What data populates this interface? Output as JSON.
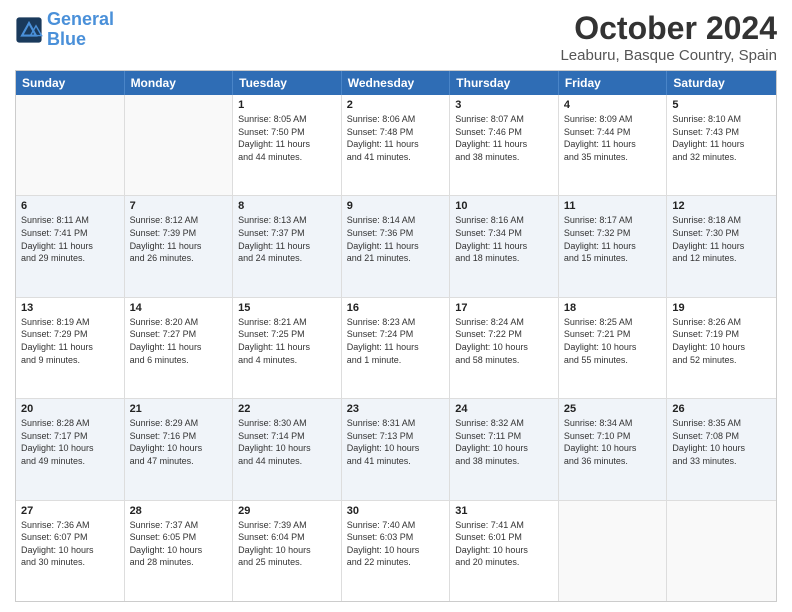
{
  "header": {
    "logo_general": "General",
    "logo_blue": "Blue",
    "month_title": "October 2024",
    "location": "Leaburu, Basque Country, Spain"
  },
  "days_of_week": [
    "Sunday",
    "Monday",
    "Tuesday",
    "Wednesday",
    "Thursday",
    "Friday",
    "Saturday"
  ],
  "weeks": [
    {
      "alt": false,
      "cells": [
        {
          "empty": true,
          "day": "",
          "lines": []
        },
        {
          "empty": true,
          "day": "",
          "lines": []
        },
        {
          "empty": false,
          "day": "1",
          "lines": [
            "Sunrise: 8:05 AM",
            "Sunset: 7:50 PM",
            "Daylight: 11 hours",
            "and 44 minutes."
          ]
        },
        {
          "empty": false,
          "day": "2",
          "lines": [
            "Sunrise: 8:06 AM",
            "Sunset: 7:48 PM",
            "Daylight: 11 hours",
            "and 41 minutes."
          ]
        },
        {
          "empty": false,
          "day": "3",
          "lines": [
            "Sunrise: 8:07 AM",
            "Sunset: 7:46 PM",
            "Daylight: 11 hours",
            "and 38 minutes."
          ]
        },
        {
          "empty": false,
          "day": "4",
          "lines": [
            "Sunrise: 8:09 AM",
            "Sunset: 7:44 PM",
            "Daylight: 11 hours",
            "and 35 minutes."
          ]
        },
        {
          "empty": false,
          "day": "5",
          "lines": [
            "Sunrise: 8:10 AM",
            "Sunset: 7:43 PM",
            "Daylight: 11 hours",
            "and 32 minutes."
          ]
        }
      ]
    },
    {
      "alt": true,
      "cells": [
        {
          "empty": false,
          "day": "6",
          "lines": [
            "Sunrise: 8:11 AM",
            "Sunset: 7:41 PM",
            "Daylight: 11 hours",
            "and 29 minutes."
          ]
        },
        {
          "empty": false,
          "day": "7",
          "lines": [
            "Sunrise: 8:12 AM",
            "Sunset: 7:39 PM",
            "Daylight: 11 hours",
            "and 26 minutes."
          ]
        },
        {
          "empty": false,
          "day": "8",
          "lines": [
            "Sunrise: 8:13 AM",
            "Sunset: 7:37 PM",
            "Daylight: 11 hours",
            "and 24 minutes."
          ]
        },
        {
          "empty": false,
          "day": "9",
          "lines": [
            "Sunrise: 8:14 AM",
            "Sunset: 7:36 PM",
            "Daylight: 11 hours",
            "and 21 minutes."
          ]
        },
        {
          "empty": false,
          "day": "10",
          "lines": [
            "Sunrise: 8:16 AM",
            "Sunset: 7:34 PM",
            "Daylight: 11 hours",
            "and 18 minutes."
          ]
        },
        {
          "empty": false,
          "day": "11",
          "lines": [
            "Sunrise: 8:17 AM",
            "Sunset: 7:32 PM",
            "Daylight: 11 hours",
            "and 15 minutes."
          ]
        },
        {
          "empty": false,
          "day": "12",
          "lines": [
            "Sunrise: 8:18 AM",
            "Sunset: 7:30 PM",
            "Daylight: 11 hours",
            "and 12 minutes."
          ]
        }
      ]
    },
    {
      "alt": false,
      "cells": [
        {
          "empty": false,
          "day": "13",
          "lines": [
            "Sunrise: 8:19 AM",
            "Sunset: 7:29 PM",
            "Daylight: 11 hours",
            "and 9 minutes."
          ]
        },
        {
          "empty": false,
          "day": "14",
          "lines": [
            "Sunrise: 8:20 AM",
            "Sunset: 7:27 PM",
            "Daylight: 11 hours",
            "and 6 minutes."
          ]
        },
        {
          "empty": false,
          "day": "15",
          "lines": [
            "Sunrise: 8:21 AM",
            "Sunset: 7:25 PM",
            "Daylight: 11 hours",
            "and 4 minutes."
          ]
        },
        {
          "empty": false,
          "day": "16",
          "lines": [
            "Sunrise: 8:23 AM",
            "Sunset: 7:24 PM",
            "Daylight: 11 hours",
            "and 1 minute."
          ]
        },
        {
          "empty": false,
          "day": "17",
          "lines": [
            "Sunrise: 8:24 AM",
            "Sunset: 7:22 PM",
            "Daylight: 10 hours",
            "and 58 minutes."
          ]
        },
        {
          "empty": false,
          "day": "18",
          "lines": [
            "Sunrise: 8:25 AM",
            "Sunset: 7:21 PM",
            "Daylight: 10 hours",
            "and 55 minutes."
          ]
        },
        {
          "empty": false,
          "day": "19",
          "lines": [
            "Sunrise: 8:26 AM",
            "Sunset: 7:19 PM",
            "Daylight: 10 hours",
            "and 52 minutes."
          ]
        }
      ]
    },
    {
      "alt": true,
      "cells": [
        {
          "empty": false,
          "day": "20",
          "lines": [
            "Sunrise: 8:28 AM",
            "Sunset: 7:17 PM",
            "Daylight: 10 hours",
            "and 49 minutes."
          ]
        },
        {
          "empty": false,
          "day": "21",
          "lines": [
            "Sunrise: 8:29 AM",
            "Sunset: 7:16 PM",
            "Daylight: 10 hours",
            "and 47 minutes."
          ]
        },
        {
          "empty": false,
          "day": "22",
          "lines": [
            "Sunrise: 8:30 AM",
            "Sunset: 7:14 PM",
            "Daylight: 10 hours",
            "and 44 minutes."
          ]
        },
        {
          "empty": false,
          "day": "23",
          "lines": [
            "Sunrise: 8:31 AM",
            "Sunset: 7:13 PM",
            "Daylight: 10 hours",
            "and 41 minutes."
          ]
        },
        {
          "empty": false,
          "day": "24",
          "lines": [
            "Sunrise: 8:32 AM",
            "Sunset: 7:11 PM",
            "Daylight: 10 hours",
            "and 38 minutes."
          ]
        },
        {
          "empty": false,
          "day": "25",
          "lines": [
            "Sunrise: 8:34 AM",
            "Sunset: 7:10 PM",
            "Daylight: 10 hours",
            "and 36 minutes."
          ]
        },
        {
          "empty": false,
          "day": "26",
          "lines": [
            "Sunrise: 8:35 AM",
            "Sunset: 7:08 PM",
            "Daylight: 10 hours",
            "and 33 minutes."
          ]
        }
      ]
    },
    {
      "alt": false,
      "cells": [
        {
          "empty": false,
          "day": "27",
          "lines": [
            "Sunrise: 7:36 AM",
            "Sunset: 6:07 PM",
            "Daylight: 10 hours",
            "and 30 minutes."
          ]
        },
        {
          "empty": false,
          "day": "28",
          "lines": [
            "Sunrise: 7:37 AM",
            "Sunset: 6:05 PM",
            "Daylight: 10 hours",
            "and 28 minutes."
          ]
        },
        {
          "empty": false,
          "day": "29",
          "lines": [
            "Sunrise: 7:39 AM",
            "Sunset: 6:04 PM",
            "Daylight: 10 hours",
            "and 25 minutes."
          ]
        },
        {
          "empty": false,
          "day": "30",
          "lines": [
            "Sunrise: 7:40 AM",
            "Sunset: 6:03 PM",
            "Daylight: 10 hours",
            "and 22 minutes."
          ]
        },
        {
          "empty": false,
          "day": "31",
          "lines": [
            "Sunrise: 7:41 AM",
            "Sunset: 6:01 PM",
            "Daylight: 10 hours",
            "and 20 minutes."
          ]
        },
        {
          "empty": true,
          "day": "",
          "lines": []
        },
        {
          "empty": true,
          "day": "",
          "lines": []
        }
      ]
    }
  ]
}
